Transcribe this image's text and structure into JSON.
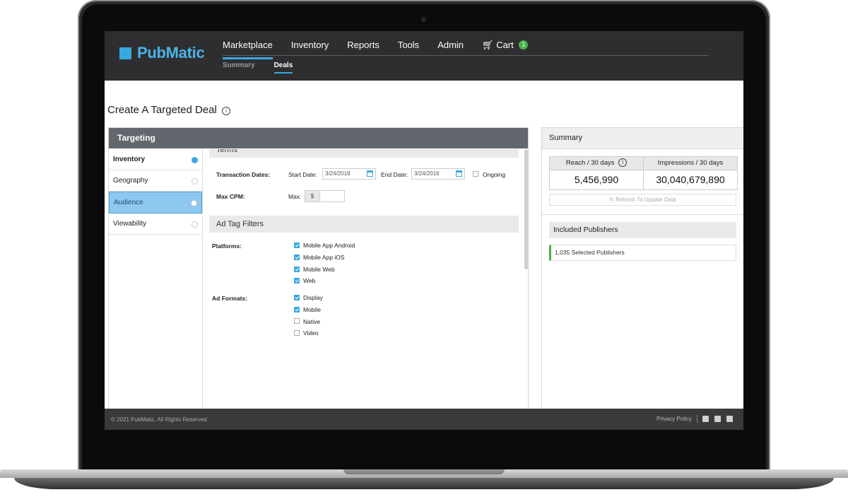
{
  "header": {
    "logo_text": "PubMatic",
    "nav": [
      "Marketplace",
      "Inventory",
      "Reports",
      "Tools",
      "Admin"
    ],
    "cart_label": "Cart",
    "cart_count": "1",
    "subnav": [
      "Summary",
      "Deals"
    ]
  },
  "page": {
    "title": "Create A Targeted Deal"
  },
  "targeting": {
    "title": "Targeting",
    "side_items": [
      "Inventory",
      "Geography",
      "Audience",
      "Viewability"
    ],
    "terms_title": "Terms",
    "transaction_dates_label": "Transaction Dates:",
    "start_date_label": "Start Date:",
    "start_date_value": "3/24/2018",
    "end_date_label": "End Date:",
    "end_date_value": "3/24/2016",
    "ongoing_label": "Ongoing",
    "max_cpm_label": "Max CPM:",
    "max_label": "Max:",
    "currency": "$",
    "ad_tag_filters_title": "Ad Tag Filters",
    "platforms_label": "Platforms:",
    "platforms": [
      "Mobile App Android",
      "Mobile App iOS",
      "Mobile Web",
      "Web"
    ],
    "ad_formats_label": "Ad Formats:",
    "ad_formats": [
      "Display",
      "Mobile",
      "Native",
      "Video"
    ]
  },
  "summary": {
    "title": "Summary",
    "reach_label": "Reach / 30 days",
    "reach_value": "5,456,990",
    "impressions_label": "Impressions / 30 days",
    "impressions_value": "30,040,679,890",
    "refresh_label": "Refresh To Update Data",
    "included_publishers_title": "Included Publishers",
    "selected_publishers": "1,035 Selected Publishers"
  },
  "footer": {
    "copyright": "© 2021 PubMatic, All Rights Reserved",
    "privacy": "Privacy Policy"
  },
  "colors": {
    "accent": "#3aa8e0",
    "topbar": "#2e2e30",
    "targeting_header": "#61676c",
    "selected_item": "#8dc8ee",
    "cart_badge": "#49b24a"
  },
  "icons": [
    "info-icon",
    "calendar-icon",
    "cart-icon",
    "refresh-icon",
    "facebook-icon",
    "twitter-icon",
    "linkedin-icon"
  ]
}
